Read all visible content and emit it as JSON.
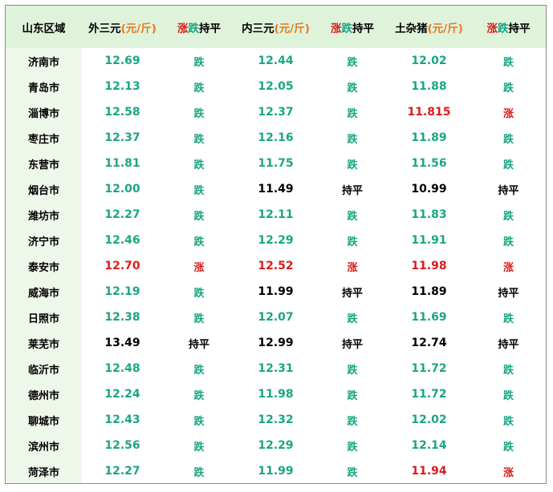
{
  "header": {
    "region": "山东区域",
    "col1_name": "外三元",
    "col1_unit": "(元/斤)",
    "col2_rise": "涨",
    "col2_fall": "跌",
    "col2_flat": "持平",
    "col3_name": "内三元",
    "col3_unit": "(元/斤)",
    "col4_rise": "涨",
    "col4_fall": "跌",
    "col4_flat": "持平",
    "col5_name": "土杂猪",
    "col5_unit": "(元/斤)",
    "col6_rise": "涨",
    "col6_fall": "跌",
    "col6_flat": "持平"
  },
  "colors": {
    "rise": "#dd1b1b",
    "fall": "#1aa683",
    "flat": "#000000",
    "header_bg": "#dff3da",
    "unit": "#e87722"
  },
  "rows": [
    {
      "city": "济南市",
      "wai": "12.69",
      "wai_trend": "跌",
      "nei": "12.44",
      "nei_trend": "跌",
      "tu": "12.02",
      "tu_trend": "跌"
    },
    {
      "city": "青岛市",
      "wai": "12.13",
      "wai_trend": "跌",
      "nei": "12.05",
      "nei_trend": "跌",
      "tu": "11.88",
      "tu_trend": "跌"
    },
    {
      "city": "淄博市",
      "wai": "12.58",
      "wai_trend": "跌",
      "nei": "12.37",
      "nei_trend": "跌",
      "tu": "11.815",
      "tu_trend": "涨"
    },
    {
      "city": "枣庄市",
      "wai": "12.37",
      "wai_trend": "跌",
      "nei": "12.16",
      "nei_trend": "跌",
      "tu": "11.89",
      "tu_trend": "跌"
    },
    {
      "city": "东营市",
      "wai": "11.81",
      "wai_trend": "跌",
      "nei": "11.75",
      "nei_trend": "跌",
      "tu": "11.56",
      "tu_trend": "跌"
    },
    {
      "city": "烟台市",
      "wai": "12.00",
      "wai_trend": "跌",
      "nei": "11.49",
      "nei_trend": "持平",
      "tu": "10.99",
      "tu_trend": "持平"
    },
    {
      "city": "潍坊市",
      "wai": "12.27",
      "wai_trend": "跌",
      "nei": "12.11",
      "nei_trend": "跌",
      "tu": "11.83",
      "tu_trend": "跌"
    },
    {
      "city": "济宁市",
      "wai": "12.46",
      "wai_trend": "跌",
      "nei": "12.29",
      "nei_trend": "跌",
      "tu": "11.91",
      "tu_trend": "跌"
    },
    {
      "city": "泰安市",
      "wai": "12.70",
      "wai_trend": "涨",
      "nei": "12.52",
      "nei_trend": "涨",
      "tu": "11.98",
      "tu_trend": "涨"
    },
    {
      "city": "威海市",
      "wai": "12.19",
      "wai_trend": "跌",
      "nei": "11.99",
      "nei_trend": "持平",
      "tu": "11.89",
      "tu_trend": "持平"
    },
    {
      "city": "日照市",
      "wai": "12.38",
      "wai_trend": "跌",
      "nei": "12.07",
      "nei_trend": "跌",
      "tu": "11.69",
      "tu_trend": "跌"
    },
    {
      "city": "莱芜市",
      "wai": "13.49",
      "wai_trend": "持平",
      "nei": "12.99",
      "nei_trend": "持平",
      "tu": "12.74",
      "tu_trend": "持平"
    },
    {
      "city": "临沂市",
      "wai": "12.48",
      "wai_trend": "跌",
      "nei": "12.31",
      "nei_trend": "跌",
      "tu": "11.72",
      "tu_trend": "跌"
    },
    {
      "city": "德州市",
      "wai": "12.24",
      "wai_trend": "跌",
      "nei": "11.98",
      "nei_trend": "跌",
      "tu": "11.72",
      "tu_trend": "跌"
    },
    {
      "city": "聊城市",
      "wai": "12.43",
      "wai_trend": "跌",
      "nei": "12.32",
      "nei_trend": "跌",
      "tu": "12.02",
      "tu_trend": "跌"
    },
    {
      "city": "滨州市",
      "wai": "12.56",
      "wai_trend": "跌",
      "nei": "12.29",
      "nei_trend": "跌",
      "tu": "12.14",
      "tu_trend": "跌"
    },
    {
      "city": "菏泽市",
      "wai": "12.27",
      "wai_trend": "跌",
      "nei": "11.99",
      "nei_trend": "跌",
      "tu": "11.94",
      "tu_trend": "涨"
    }
  ]
}
